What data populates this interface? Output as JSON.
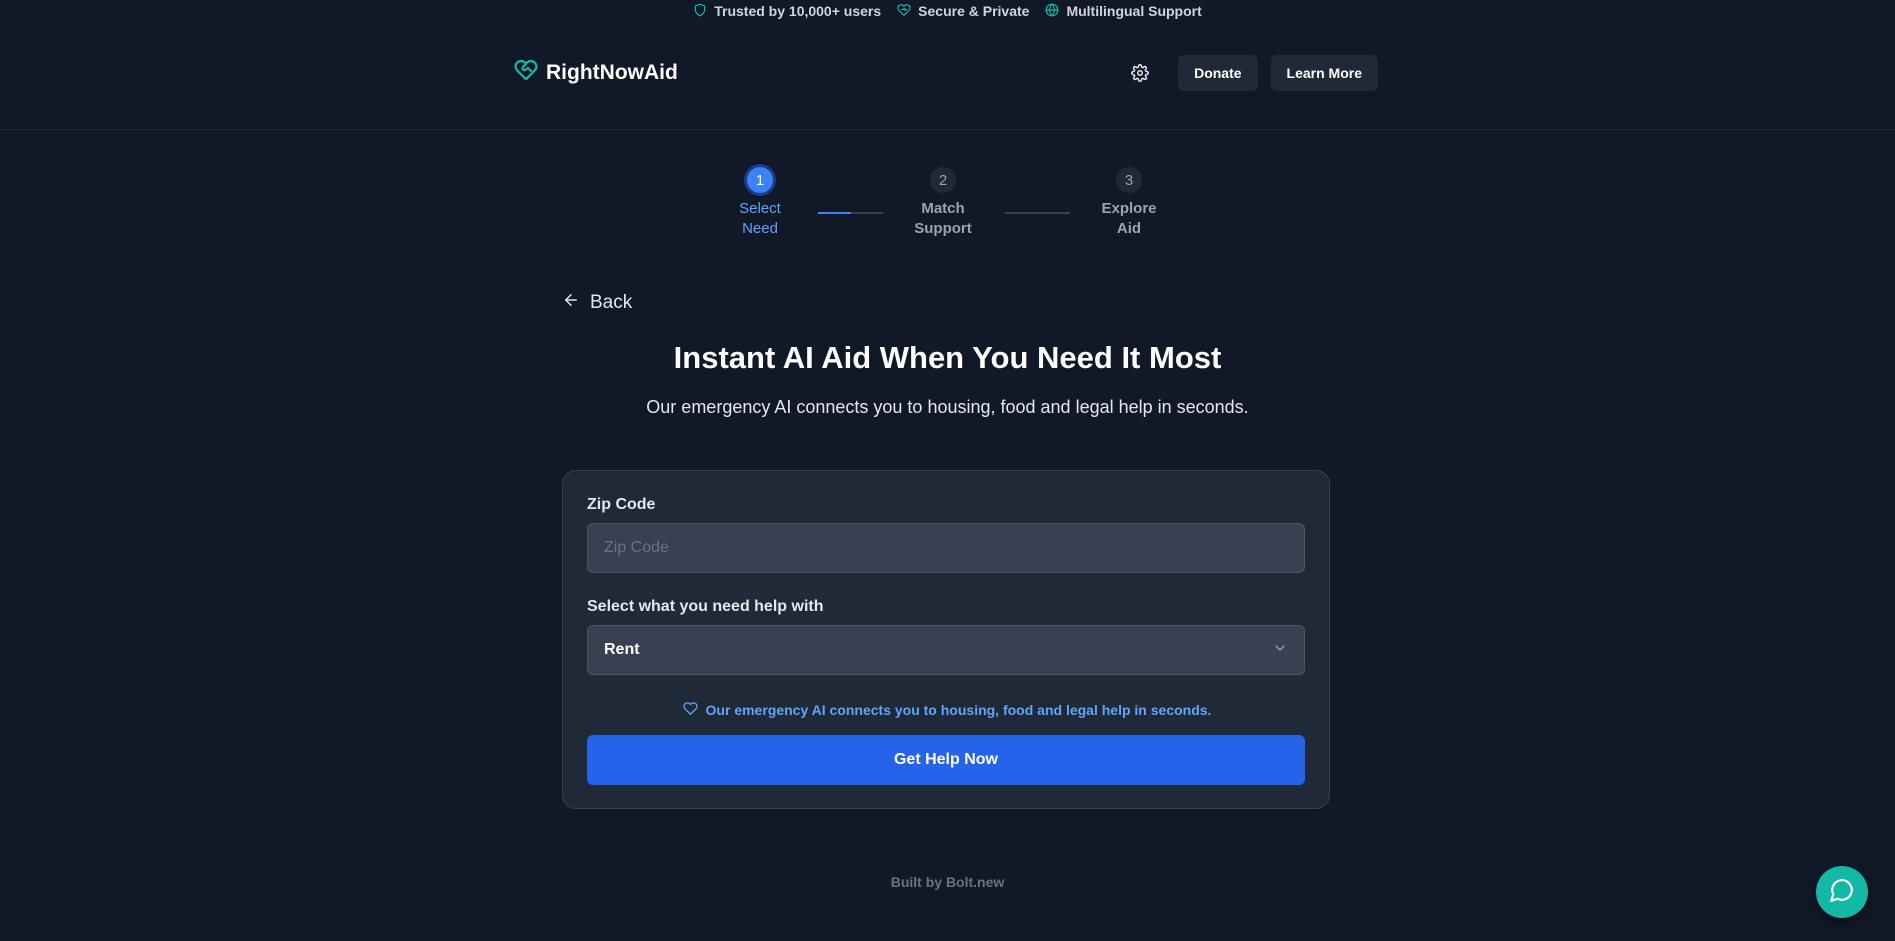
{
  "trust_bar": {
    "items": [
      {
        "icon": "shield-icon",
        "label": "Trusted by 10,000+ users"
      },
      {
        "icon": "heart-icon",
        "label": "Secure & Private"
      },
      {
        "icon": "globe-icon",
        "label": "Multilingual Support"
      }
    ]
  },
  "header": {
    "brand": "RightNowAid",
    "actions": {
      "settings_icon": "gear-icon",
      "donate_label": "Donate",
      "learn_more_label": "Learn More"
    }
  },
  "stepper": {
    "steps": [
      {
        "number": "1",
        "line1": "Select",
        "line2": "Need",
        "state": "active"
      },
      {
        "number": "2",
        "line1": "Match",
        "line2": "Support",
        "state": "inactive"
      },
      {
        "number": "3",
        "line1": "Explore",
        "line2": "Aid",
        "state": "inactive"
      }
    ]
  },
  "back_label": "Back",
  "hero": {
    "title": "Instant AI Aid When You Need It Most",
    "subtitle": "Our emergency AI connects you to housing, food and legal help in seconds."
  },
  "form": {
    "zip_label": "Zip Code",
    "zip_placeholder": "Zip Code",
    "zip_value": "",
    "need_label": "Select what you need help with",
    "need_selected": "Rent",
    "note": "Our emergency AI connects you to housing, food and legal help in seconds.",
    "submit_label": "Get Help Now"
  },
  "footer": {
    "credit": "Built by Bolt.new"
  },
  "colors": {
    "background": "#111827",
    "card": "#1f2937",
    "accent": "#3b82f6",
    "cta": "#2563eb",
    "brand_teal": "#14b8a6"
  }
}
